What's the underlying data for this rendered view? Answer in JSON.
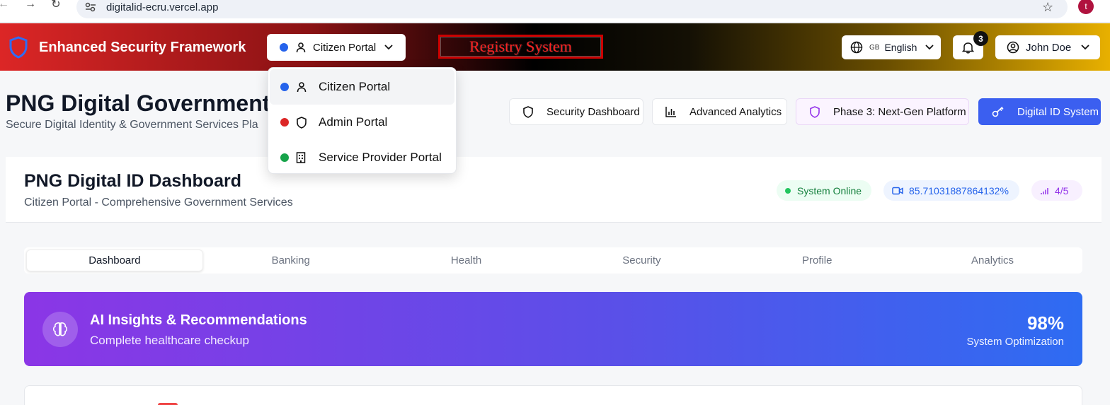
{
  "browser": {
    "url": "digitalid-ecru.vercel.app",
    "profile_initial": "t"
  },
  "header": {
    "brand_title": "Enhanced Security Framework",
    "portal_selected": "Citizen Portal",
    "registry_label": "Registry System",
    "language_flag": "GB",
    "language": "English",
    "notification_count": "3",
    "user_name": "John Doe"
  },
  "portal_dropdown": {
    "items": [
      {
        "label": "Citizen Portal",
        "color": "#2563eb",
        "icon": "user-icon"
      },
      {
        "label": "Admin Portal",
        "color": "#dc2626",
        "icon": "shield-icon"
      },
      {
        "label": "Service Provider Portal",
        "color": "#16a34a",
        "icon": "building-icon"
      }
    ]
  },
  "hero": {
    "title": "PNG Digital Government",
    "subtitle": "Secure Digital Identity & Government Services Pla"
  },
  "actions": {
    "security_dashboard": "Security Dashboard",
    "advanced_analytics": "Advanced Analytics",
    "phase3": "Phase 3: Next-Gen Platform",
    "digital_id": "Digital ID System"
  },
  "dashboard": {
    "title": "PNG Digital ID Dashboard",
    "subtitle": "Citizen Portal - Comprehensive Government Services",
    "status_online": "System Online",
    "metric": "85.71031887864132%",
    "signal": "4/5"
  },
  "tabs": [
    "Dashboard",
    "Banking",
    "Health",
    "Security",
    "Profile",
    "Analytics"
  ],
  "ai_banner": {
    "title": "AI Insights & Recommendations",
    "subtitle": "Complete healthcare checkup",
    "percent": "98%",
    "percent_label": "System Optimization"
  },
  "colors": {
    "accent": "#3b5ff0",
    "online": "#22c55e",
    "banner_start": "#8b36e6",
    "banner_end": "#2e6cf2"
  }
}
